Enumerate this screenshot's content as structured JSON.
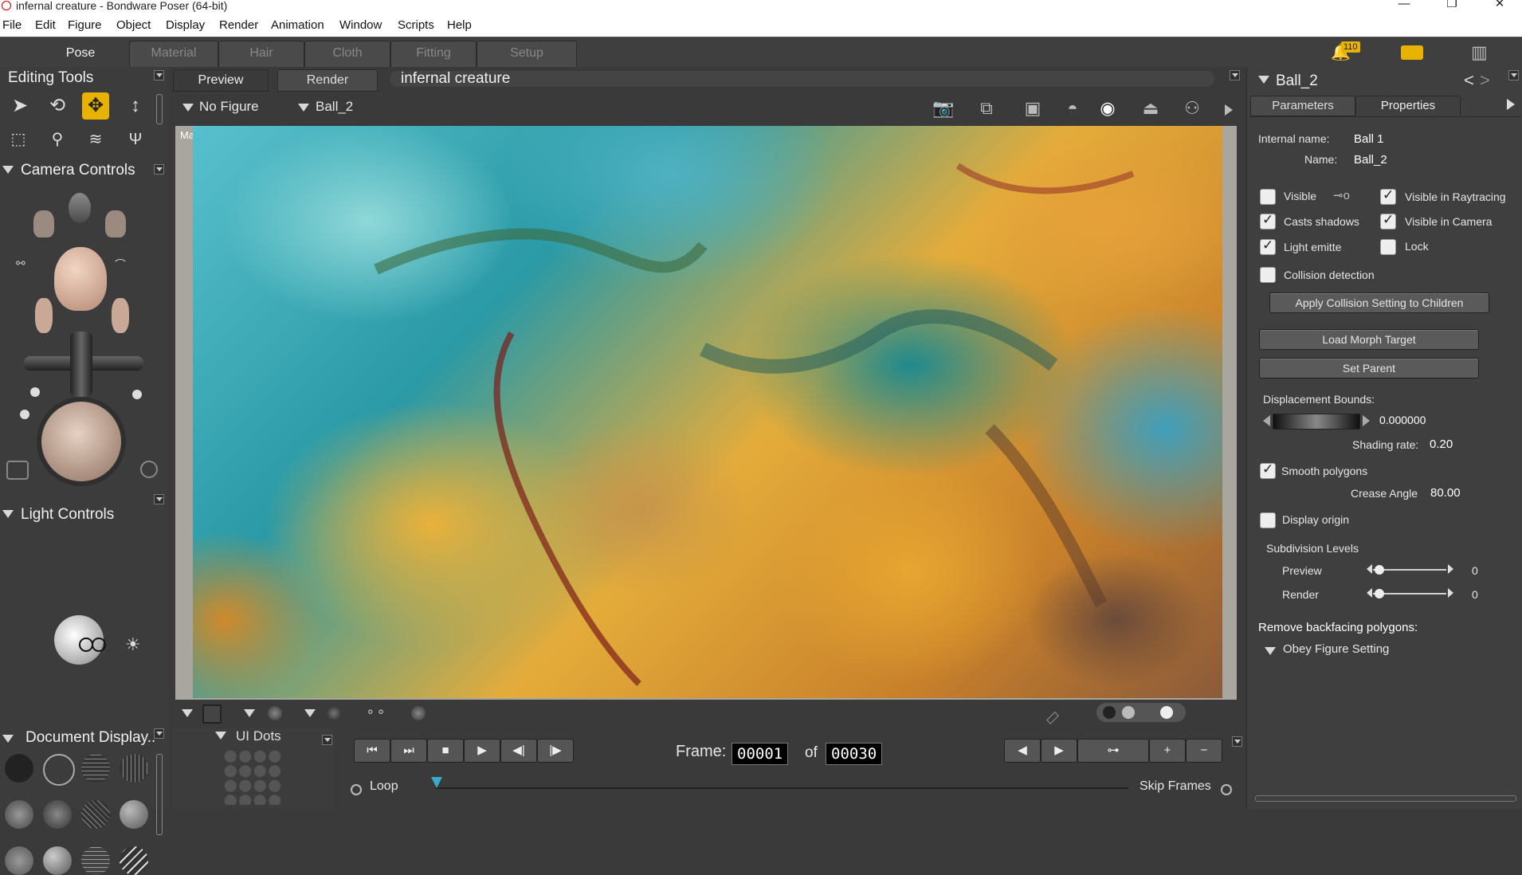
{
  "window": {
    "title": "infernal creature - Bondware Poser (64-bit)"
  },
  "menu": [
    "File",
    "Edit",
    "Figure",
    "Object",
    "Display",
    "Render",
    "Animation",
    "Window",
    "Scripts",
    "Help"
  ],
  "rooms": [
    "Pose",
    "Material",
    "Hair",
    "Cloth",
    "Fitting",
    "Setup"
  ],
  "notifications": {
    "count": "110"
  },
  "panels": {
    "editing_tools": "Editing Tools",
    "camera_controls": "Camera Controls",
    "light_controls": "Light Controls",
    "document_display": "Document  Display..",
    "ui_dots": "UI Dots"
  },
  "viewport": {
    "tabs": [
      "Preview",
      "Render"
    ],
    "document_name": "infernal creature",
    "figure_select": "No Figure",
    "actor_select": "Ball_2",
    "camera_label": "Main Camera"
  },
  "timeline": {
    "frame_label": "Frame:",
    "frame": "00001",
    "of": "of",
    "total": "00030",
    "loop": "Loop",
    "skip_frames": "Skip Frames"
  },
  "properties": {
    "title": "Ball_2",
    "tabs": [
      "Parameters",
      "Properties"
    ],
    "internal_name_label": "Internal name:",
    "internal_name": "Ball 1",
    "name_label": "Name:",
    "name": "Ball_2",
    "checks": {
      "visible": "Visible",
      "visible_raytracing": "Visible in Raytracing",
      "casts_shadows": "Casts shadows",
      "visible_camera": "Visible in Camera",
      "light_emitter": "Light emitte",
      "lock": "Lock",
      "collision": "Collision detection",
      "smooth": "Smooth polygons",
      "display_origin": "Display origin"
    },
    "apply_collision": "Apply Collision Setting to Children",
    "load_morph": "Load Morph Target",
    "set_parent": "Set Parent",
    "displacement_label": "Displacement Bounds:",
    "displacement_value": "0.000000",
    "shading_label": "Shading rate:",
    "shading_value": "0.20",
    "crease_label": "Crease Angle",
    "crease_value": "80.00",
    "subdiv_label": "Subdivision Levels",
    "preview_label": "Preview",
    "preview_value": "0",
    "render_label": "Render",
    "render_value": "0",
    "backface_label": "Remove backfacing polygons:",
    "backface_value": "Obey Figure Setting"
  }
}
